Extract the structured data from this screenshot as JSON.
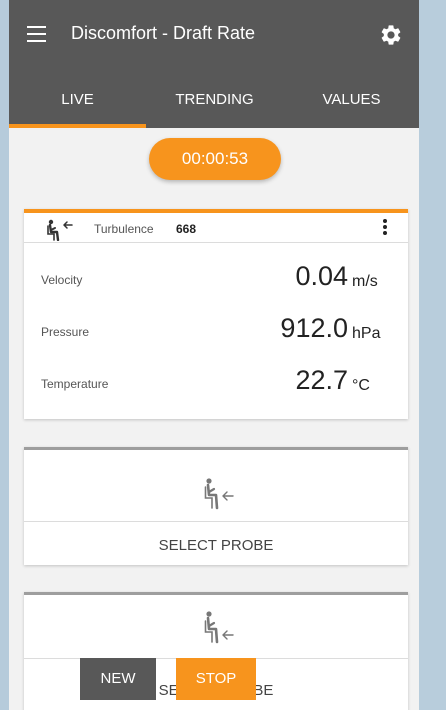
{
  "colors": {
    "accent": "#f7941d",
    "toolbar": "#585858",
    "background": "#f2f2f2"
  },
  "header": {
    "title": "Discomfort - Draft Rate",
    "menu_icon": "hamburger-menu-icon",
    "settings_icon": "gear-icon"
  },
  "tabs": [
    {
      "label": "LIVE",
      "active": true
    },
    {
      "label": "TRENDING",
      "active": false
    },
    {
      "label": "VALUES",
      "active": false
    }
  ],
  "timer": "00:00:53",
  "probe_card": {
    "icon": "seated-person-draft-icon",
    "turbulence_label": "Turbulence",
    "turbulence_value": "668",
    "measurements": [
      {
        "label": "Velocity",
        "value": "0.04",
        "unit": "m/s"
      },
      {
        "label": "Pressure",
        "value": "912.0",
        "unit": "hPa"
      },
      {
        "label": "Temperature",
        "value": "22.7",
        "unit": "°C"
      }
    ]
  },
  "empty_slots": [
    {
      "icon": "seated-person-draft-icon",
      "label": "SELECT PROBE"
    },
    {
      "icon": "seated-person-draft-icon",
      "label": "SELECT PROBE"
    }
  ],
  "buttons": {
    "new": "NEW",
    "stop": "STOP"
  }
}
